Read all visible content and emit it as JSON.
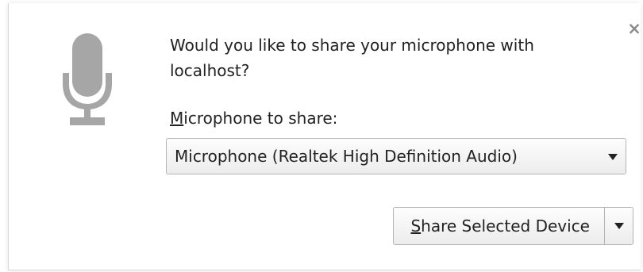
{
  "dialog": {
    "question": "Would you like to share your microphone with localhost?",
    "select_label_mnemonic": "M",
    "select_label_rest": "icrophone to share:",
    "selected_device": "Microphone (Realtek High Definition Audio)",
    "share_button_mnemonic": "S",
    "share_button_rest": "hare Selected Device",
    "close_glyph": "×"
  },
  "icons": {
    "microphone": "microphone-icon",
    "close": "close-icon",
    "dropdown": "chevron-down-icon"
  },
  "colors": {
    "icon_gray": "#a6a6a6",
    "text": "#222222",
    "border": "#b4b4b4",
    "close_gray": "#8a8a8a"
  }
}
